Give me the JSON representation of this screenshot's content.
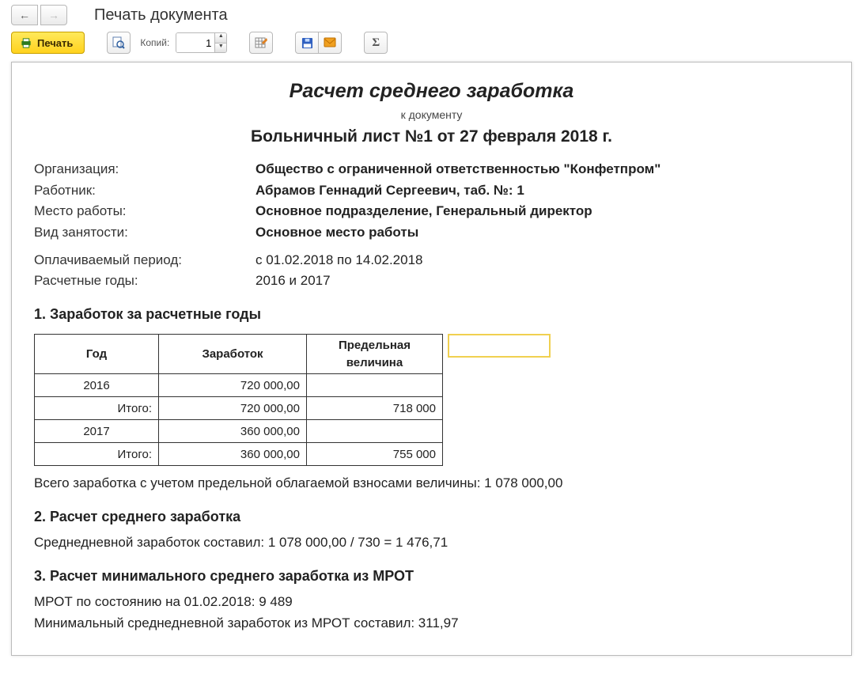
{
  "window": {
    "title": "Печать документа"
  },
  "toolbar": {
    "print_label": "Печать",
    "copies_label": "Копий:",
    "copies_value": "1"
  },
  "doc": {
    "title": "Расчет среднего заработка",
    "subtitle": "к документу",
    "header": "Больничный лист №1 от 27 февраля 2018 г.",
    "info": {
      "org_label": "Организация:",
      "org_value": "Общество с ограниченной ответственностью \"Конфетпром\"",
      "emp_label": "Работник:",
      "emp_value": "Абрамов Геннадий Сергеевич, таб. №: 1",
      "place_label": "Место работы:",
      "place_value": "Основное подразделение, Генеральный директор",
      "type_label": "Вид занятости:",
      "type_value": "Основное место работы",
      "period_label": "Оплачиваемый период:",
      "period_value": "с 01.02.2018 по 14.02.2018",
      "years_label": "Расчетные годы:",
      "years_value": "2016 и 2017"
    },
    "section1": {
      "title": "1. Заработок за расчетные годы",
      "head_year": "Год",
      "head_earn": "Заработок",
      "head_lim": "Предельная величина",
      "rows": [
        {
          "year": "2016",
          "earn": "720 000,00",
          "lim": ""
        },
        {
          "year": "Итого:",
          "earn": "720 000,00",
          "lim": "718 000"
        },
        {
          "year": "2017",
          "earn": "360 000,00",
          "lim": ""
        },
        {
          "year": "Итого:",
          "earn": "360 000,00",
          "lim": "755 000"
        }
      ],
      "total_line": "Всего заработка с учетом предельной облагаемой взносами величины: 1 078 000,00"
    },
    "section2": {
      "title": "2. Расчет среднего заработка",
      "line": "Среднедневной заработок составил: 1 078 000,00 / 730 = 1 476,71"
    },
    "section3": {
      "title": "3. Расчет минимального среднего заработка из МРОТ",
      "line1": "МРОТ по состоянию на 01.02.2018: 9 489",
      "line2": "Минимальный среднедневной заработок из МРОТ составил: 311,97"
    }
  }
}
